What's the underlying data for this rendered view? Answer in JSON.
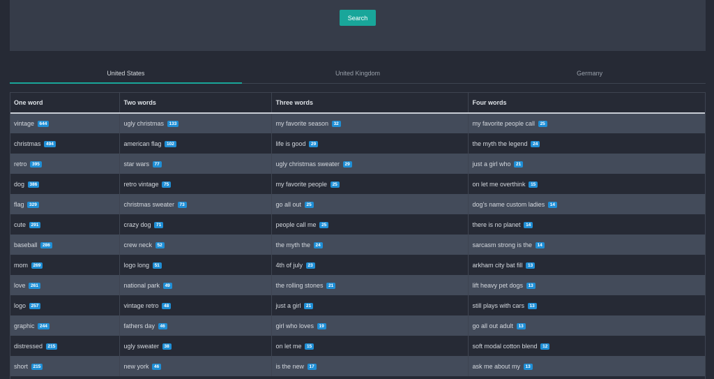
{
  "search": {
    "button_label": "Search"
  },
  "tabs": [
    {
      "label": "United States",
      "active": true
    },
    {
      "label": "United Kingdom",
      "active": false
    },
    {
      "label": "Germany",
      "active": false
    }
  ],
  "table": {
    "headers": [
      "One word",
      "Two words",
      "Three words",
      "Four words"
    ],
    "rows": [
      [
        [
          "vintage",
          "644"
        ],
        [
          "ugly christmas",
          "133"
        ],
        [
          "my favorite season",
          "32"
        ],
        [
          "my favorite people call",
          "25"
        ]
      ],
      [
        [
          "christmas",
          "494"
        ],
        [
          "american flag",
          "102"
        ],
        [
          "life is good",
          "29"
        ],
        [
          "the myth the legend",
          "24"
        ]
      ],
      [
        [
          "retro",
          "395"
        ],
        [
          "star wars",
          "77"
        ],
        [
          "ugly christmas sweater",
          "29"
        ],
        [
          "just a girl who",
          "21"
        ]
      ],
      [
        [
          "dog",
          "386"
        ],
        [
          "retro vintage",
          "75"
        ],
        [
          "my favorite people",
          "25"
        ],
        [
          "on let me overthink",
          "15"
        ]
      ],
      [
        [
          "flag",
          "329"
        ],
        [
          "christmas sweater",
          "73"
        ],
        [
          "go all out",
          "25"
        ],
        [
          "dog's name custom ladies",
          "14"
        ]
      ],
      [
        [
          "cute",
          "291"
        ],
        [
          "crazy dog",
          "71"
        ],
        [
          "people call me",
          "25"
        ],
        [
          "there is no planet",
          "14"
        ]
      ],
      [
        [
          "baseball",
          "286"
        ],
        [
          "crew neck",
          "52"
        ],
        [
          "the myth the",
          "24"
        ],
        [
          "sarcasm strong is the",
          "14"
        ]
      ],
      [
        [
          "mom",
          "269"
        ],
        [
          "logo long",
          "51"
        ],
        [
          "4th of july",
          "23"
        ],
        [
          "arkham city bat fill",
          "13"
        ]
      ],
      [
        [
          "love",
          "261"
        ],
        [
          "national park",
          "49"
        ],
        [
          "the rolling stones",
          "21"
        ],
        [
          "lift heavy pet dogs",
          "13"
        ]
      ],
      [
        [
          "logo",
          "257"
        ],
        [
          "vintage retro",
          "48"
        ],
        [
          "just a girl",
          "21"
        ],
        [
          "still plays with cars",
          "13"
        ]
      ],
      [
        [
          "graphic",
          "244"
        ],
        [
          "fathers day",
          "46"
        ],
        [
          "girl who loves",
          "19"
        ],
        [
          "go all out adult",
          "13"
        ]
      ],
      [
        [
          "distressed",
          "215"
        ],
        [
          "ugly sweater",
          "38"
        ],
        [
          "on let me",
          "15"
        ],
        [
          "soft modal cotton blend",
          "12"
        ]
      ],
      [
        [
          "short",
          "215"
        ],
        [
          "new york",
          "46"
        ],
        [
          "is the new",
          "17"
        ],
        [
          "ask me about my",
          "13"
        ]
      ]
    ]
  },
  "colors": {
    "accent": "#19a69a",
    "badge": "#1f8fd6",
    "background": "#262a35",
    "panel": "#363c49",
    "row_alt": "#434b5a"
  }
}
